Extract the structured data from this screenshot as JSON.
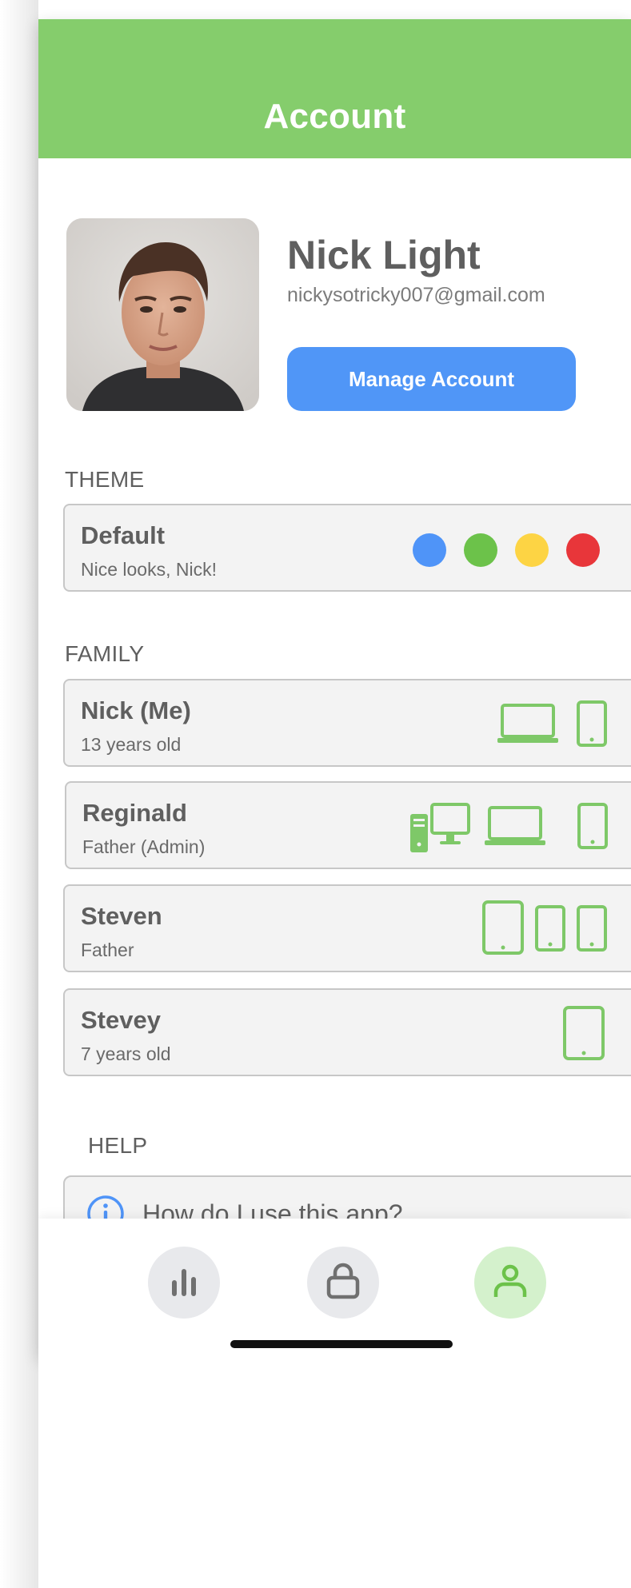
{
  "header": {
    "title": "Account"
  },
  "profile": {
    "name": "Nick Light",
    "email": "nickysotricky007@gmail.com",
    "manage_label": "Manage Account"
  },
  "theme": {
    "section_label": "THEME",
    "name": "Default",
    "subtitle": "Nice looks, Nick!",
    "colors": [
      "#4f94f8",
      "#6cc24a",
      "#fdd444",
      "#e8363a"
    ]
  },
  "family": {
    "section_label": "FAMILY",
    "members": [
      {
        "name": "Nick (Me)",
        "subtitle": "13 years old",
        "devices": [
          "laptop-icon",
          "phone-icon"
        ]
      },
      {
        "name": "Reginald",
        "subtitle": "Father (Admin)",
        "devices": [
          "desktop-icon",
          "laptop-icon",
          "phone-icon"
        ]
      },
      {
        "name": "Steven",
        "subtitle": "Father",
        "devices": [
          "tablet-icon",
          "phone-icon",
          "phone-icon"
        ]
      },
      {
        "name": "Stevey",
        "subtitle": "7 years old",
        "devices": [
          "tablet-icon"
        ]
      }
    ]
  },
  "help": {
    "section_label": "HELP",
    "items": [
      {
        "label": "How do I use this app?",
        "icon": "info-icon"
      }
    ]
  },
  "tabbar": {
    "items": [
      {
        "icon": "bar-chart-icon",
        "active": false
      },
      {
        "icon": "lock-icon",
        "active": false
      },
      {
        "icon": "user-icon",
        "active": true
      }
    ],
    "accent": "#85cd6c",
    "active_bg": "#d4f1cc",
    "inactive_bg": "#e8e9ec"
  }
}
